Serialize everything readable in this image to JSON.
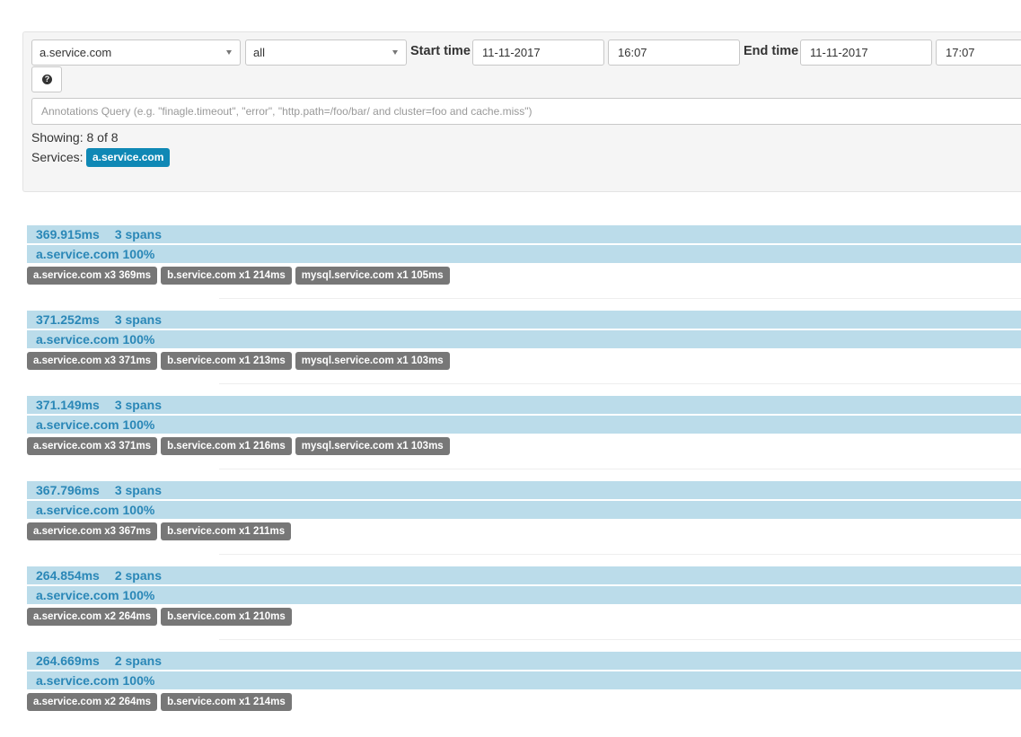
{
  "filters": {
    "service": "a.service.com",
    "span": "all",
    "start_label": "Start time",
    "start_date": "11-11-2017",
    "start_time": "16:07",
    "end_label": "End time",
    "end_date": "11-11-2017",
    "end_time": "17:07",
    "help_glyph": "?",
    "query_placeholder": "Annotations Query (e.g. \"finagle.timeout\", \"error\", \"http.path=/foo/bar/ and cluster=foo and cache.miss\")"
  },
  "summary": {
    "showing": "Showing: 8 of 8",
    "services_label": "Services:",
    "service_badge": "a.service.com"
  },
  "traces": [
    {
      "duration": "369.915ms",
      "spans": "3 spans",
      "service_pct": "a.service.com 100%",
      "tags": [
        "a.service.com x3 369ms",
        "b.service.com x1 214ms",
        "mysql.service.com x1 105ms"
      ]
    },
    {
      "duration": "371.252ms",
      "spans": "3 spans",
      "service_pct": "a.service.com 100%",
      "tags": [
        "a.service.com x3 371ms",
        "b.service.com x1 213ms",
        "mysql.service.com x1 103ms"
      ]
    },
    {
      "duration": "371.149ms",
      "spans": "3 spans",
      "service_pct": "a.service.com 100%",
      "tags": [
        "a.service.com x3 371ms",
        "b.service.com x1 216ms",
        "mysql.service.com x1 103ms"
      ]
    },
    {
      "duration": "367.796ms",
      "spans": "3 spans",
      "service_pct": "a.service.com 100%",
      "tags": [
        "a.service.com x3 367ms",
        "b.service.com x1 211ms"
      ]
    },
    {
      "duration": "264.854ms",
      "spans": "2 spans",
      "service_pct": "a.service.com 100%",
      "tags": [
        "a.service.com x2 264ms",
        "b.service.com x1 210ms"
      ]
    },
    {
      "duration": "264.669ms",
      "spans": "2 spans",
      "service_pct": "a.service.com 100%",
      "tags": [
        "a.service.com x2 264ms",
        "b.service.com x1 214ms"
      ]
    }
  ]
}
